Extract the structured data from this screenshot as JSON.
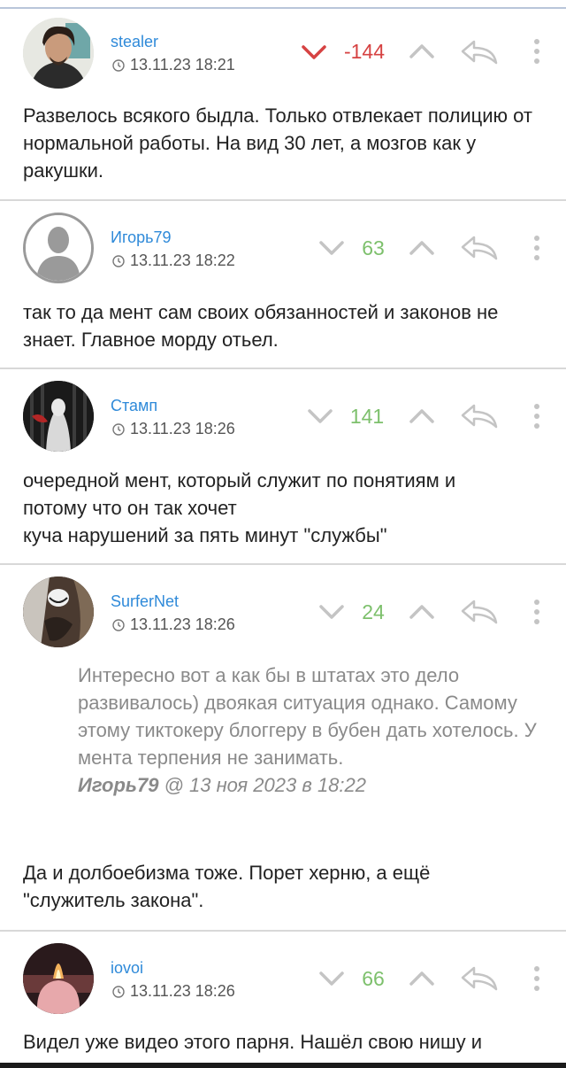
{
  "comments": [
    {
      "author": "stealer",
      "date": "13.11.23 18:21",
      "score": "-144",
      "score_type": "negative",
      "text": "Развелось всякого быдла. Только отвлекает полицию от нормальной работы. На вид 30 лет, а мозгов как у ракушки."
    },
    {
      "author": "Игорь79",
      "date": "13.11.23 18:22",
      "score": "63",
      "score_type": "positive",
      "text": "так то да мент сам своих обязанностей и законов не знает. Главное морду отьел."
    },
    {
      "author": "Стамп",
      "date": "13.11.23 18:26",
      "score": "141",
      "score_type": "positive",
      "text_lines": [
        "очередной мент, который служит по понятиям и",
        "потому что он так хочет",
        "куча нарушений за пять минут \"службы\""
      ]
    },
    {
      "author": "SurferNet",
      "date": "13.11.23 18:26",
      "score": "24",
      "score_type": "positive",
      "quote": "Интересно вот а как бы в штатах это дело развивалось) двоякая ситуация однако. Самому этому тиктокеру блоггеру в бубен дать хотелось. У мента терпения не занимать.",
      "quote_author": "Игорь79",
      "quote_date": " @ 13 ноя 2023 в 18:22",
      "text": "Да и долбоебизма тоже. Порет херню, а ещё \"служитель закона\"."
    },
    {
      "author": "iovoi",
      "date": "13.11.23 18:26",
      "score": "66",
      "score_type": "positive",
      "text": "Видел уже видео этого парня. Нашёл свою нишу и"
    }
  ],
  "icons": {
    "vote_down": "chevron-down-icon",
    "vote_up": "chevron-up-icon",
    "reply": "reply-icon",
    "more": "more-vertical-icon",
    "clock": "clock-icon"
  },
  "colors": {
    "author": "#2f8ad9",
    "negative": "#d64242",
    "positive": "#7dc06c",
    "icon": "#c4c4c4"
  }
}
